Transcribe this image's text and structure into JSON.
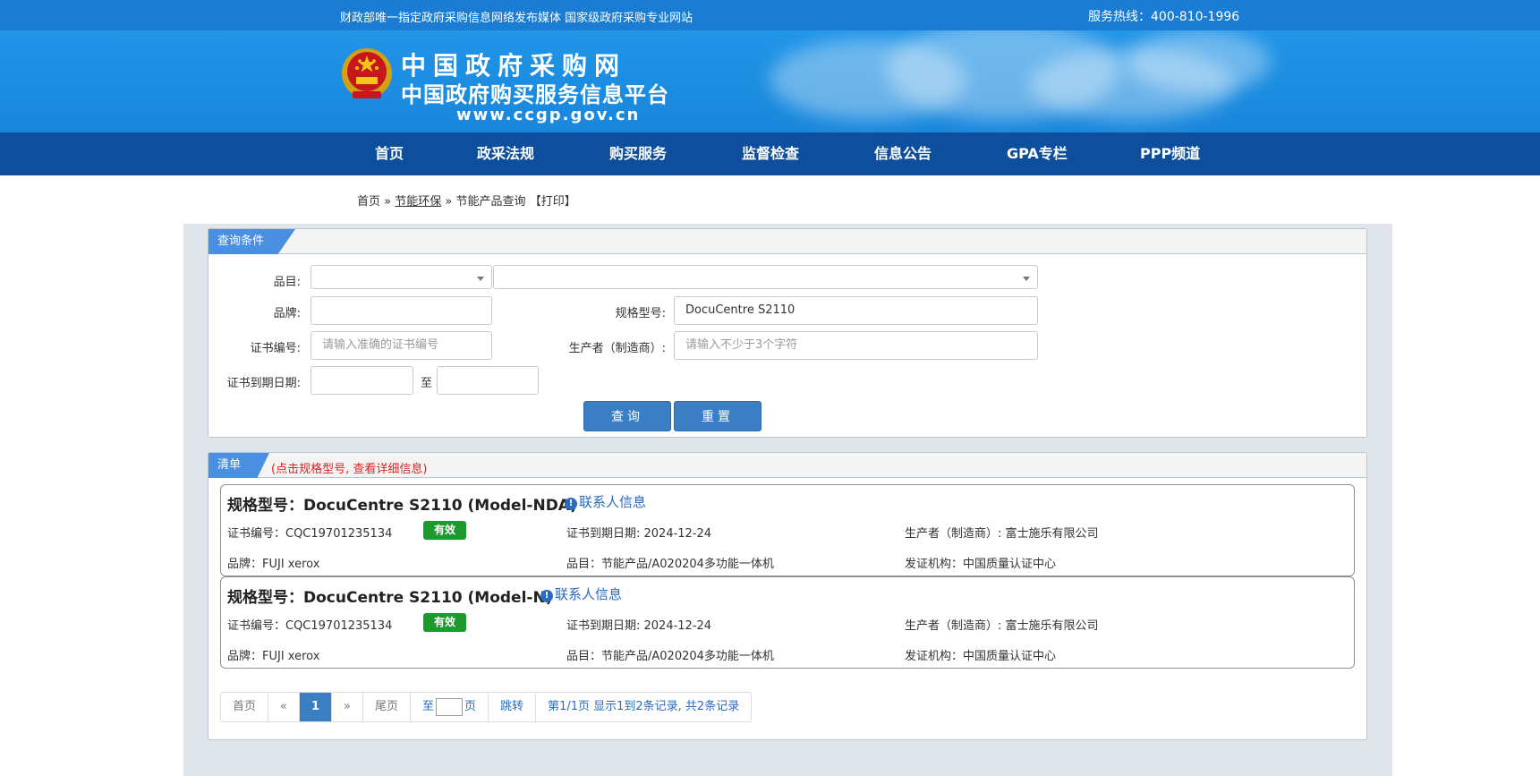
{
  "topbar": {
    "slogan": "财政部唯一指定政府采购信息网络发布媒体 国家级政府采购专业网站",
    "hotline": "服务热线：400-810-1996"
  },
  "banner": {
    "title": "中国政府采购网",
    "subtitle": "中国政府购买服务信息平台",
    "url": "www.ccgp.gov.cn",
    "emblem_icon": "national-emblem-icon"
  },
  "nav": {
    "items": [
      "首页",
      "政采法规",
      "购买服务",
      "监督检查",
      "信息公告",
      "GPA专栏",
      "PPP频道"
    ]
  },
  "breadcrumb": {
    "home": "首页",
    "sep1": "»",
    "section": "节能环保",
    "sep2": "»",
    "page": "节能产品查询",
    "print": "【打印】"
  },
  "query": {
    "tab": "查询条件",
    "category_label": "品目:",
    "brand_label": "品牌:",
    "model_label": "规格型号:",
    "model_value": "DocuCentre S2110",
    "cert_label": "证书编号:",
    "cert_placeholder": "请输入准确的证书编号",
    "maker_label": "生产者（制造商）:",
    "maker_placeholder": "请输入不少于3个字符",
    "expiry_label": "证书到期日期:",
    "to": "至",
    "search_btn": "查询",
    "reset_btn": "重置"
  },
  "list": {
    "tab": "清单",
    "note": "(点击规格型号, 查看详细信息)",
    "records": [
      {
        "title": "规格型号：DocuCentre S2110 (Model-NDA)",
        "contact": "联系人信息",
        "cert": "证书编号：CQC19701235134",
        "status": "有效",
        "expiry": "证书到期日期: 2024-12-24",
        "maker": "生产者（制造商）: 富士施乐有限公司",
        "brand": "品牌：FUJI xerox",
        "category": "品目：节能产品/A020204多功能一体机",
        "issuer": "发证机构：中国质量认证中心"
      },
      {
        "title": "规格型号：DocuCentre S2110 (Model-N)",
        "contact": "联系人信息",
        "cert": "证书编号：CQC19701235134",
        "status": "有效",
        "expiry": "证书到期日期: 2024-12-24",
        "maker": "生产者（制造商）: 富士施乐有限公司",
        "brand": "品牌：FUJI xerox",
        "category": "品目：节能产品/A020204多功能一体机",
        "issuer": "发证机构：中国质量认证中心"
      }
    ]
  },
  "pager": {
    "first": "首页",
    "prev": "«",
    "current": "1",
    "next": "»",
    "last": "尾页",
    "goto_prefix": "至",
    "goto_suffix": "页",
    "jump": "跳转",
    "summary": "第1/1页  显示1到2条记录, 共2条记录"
  },
  "colors": {
    "topbar": "#1a7cd3",
    "nav": "#0d4f9c",
    "button": "#3a7fc4",
    "badge_valid": "#1d9a2e",
    "link": "#2a6bbf"
  }
}
